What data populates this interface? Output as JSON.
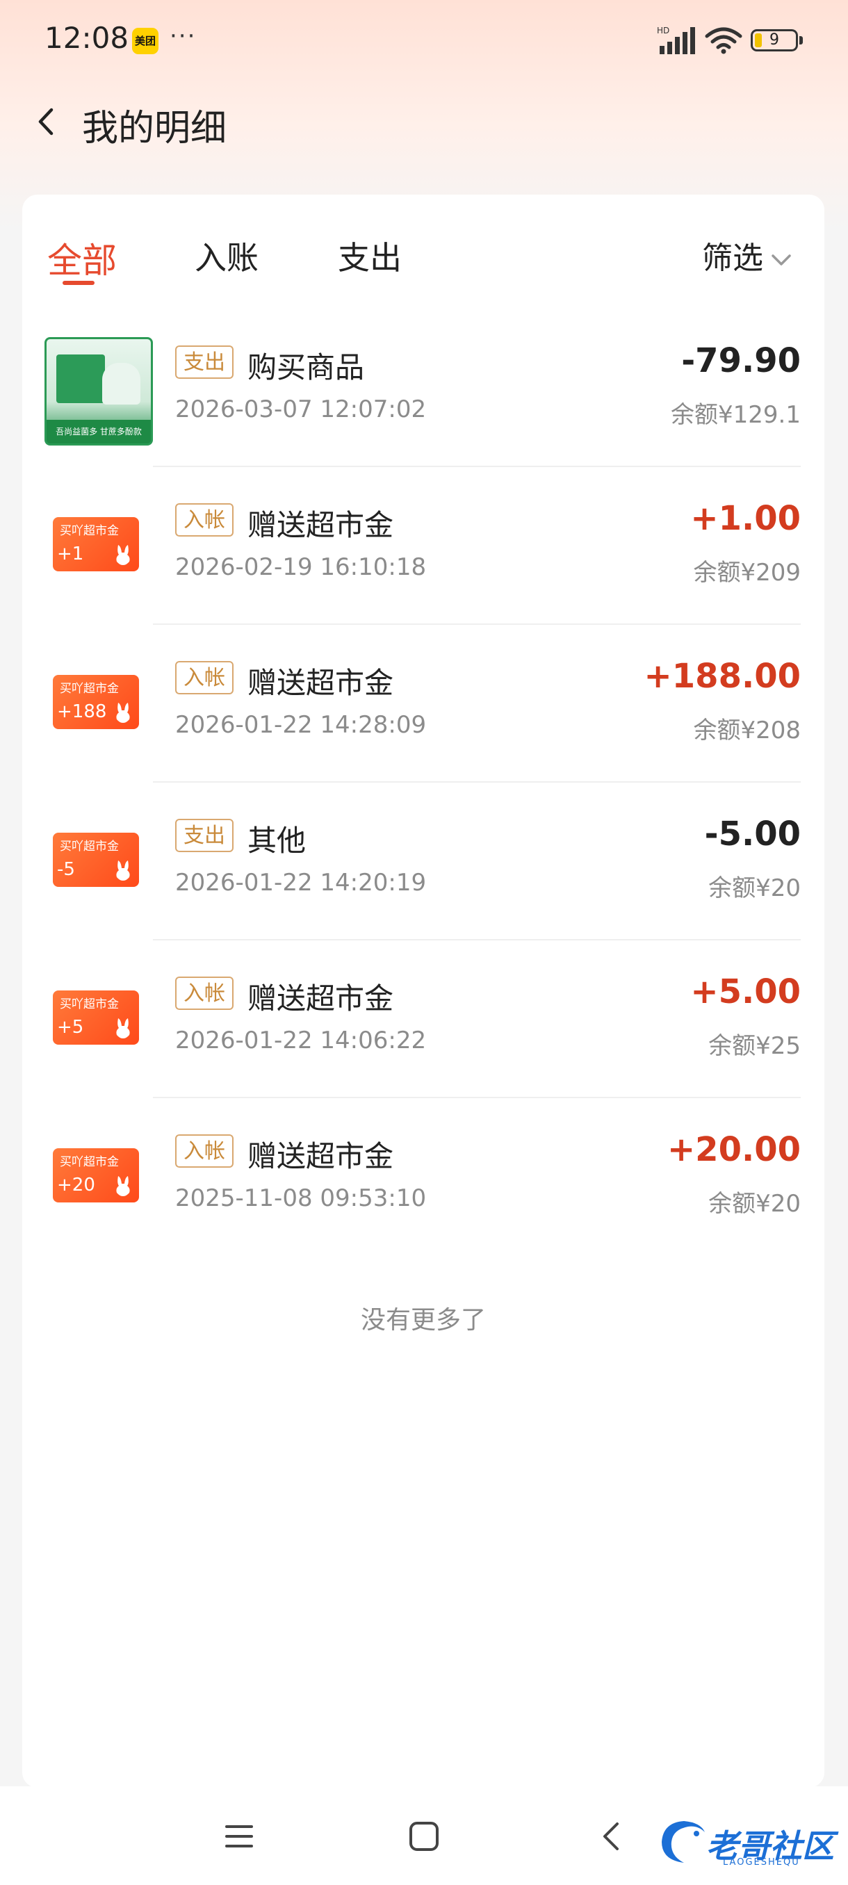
{
  "status_bar": {
    "time": "12:08",
    "app_badge": "美团",
    "more": "···",
    "network": "HD",
    "battery": "9"
  },
  "header": {
    "title": "我的明细"
  },
  "tabs": [
    {
      "label": "全部",
      "active": true
    },
    {
      "label": "入账",
      "active": false
    },
    {
      "label": "支出",
      "active": false
    }
  ],
  "filter": {
    "label": "筛选"
  },
  "records": [
    {
      "thumb": "product",
      "thumb_text": "吾尚益菌多 甘蔗多酚款",
      "tag": "支出",
      "name": "购买商品",
      "time": "2026-03-07 12:07:02",
      "amount": "-79.90",
      "balance": "余额¥129.1",
      "type": "out"
    },
    {
      "thumb": "coupon",
      "coupon_label": "买吖超市金",
      "coupon_value": "+1",
      "tag": "入帐",
      "name": "赠送超市金",
      "time": "2026-02-19 16:10:18",
      "amount": "+1.00",
      "balance": "余额¥209",
      "type": "in"
    },
    {
      "thumb": "coupon",
      "coupon_label": "买吖超市金",
      "coupon_value": "+188",
      "tag": "入帐",
      "name": "赠送超市金",
      "time": "2026-01-22 14:28:09",
      "amount": "+188.00",
      "balance": "余额¥208",
      "type": "in"
    },
    {
      "thumb": "coupon",
      "coupon_label": "买吖超市金",
      "coupon_value": "-5",
      "tag": "支出",
      "name": "其他",
      "time": "2026-01-22 14:20:19",
      "amount": "-5.00",
      "balance": "余额¥20",
      "type": "out"
    },
    {
      "thumb": "coupon",
      "coupon_label": "买吖超市金",
      "coupon_value": "+5",
      "tag": "入帐",
      "name": "赠送超市金",
      "time": "2026-01-22 14:06:22",
      "amount": "+5.00",
      "balance": "余额¥25",
      "type": "in"
    },
    {
      "thumb": "coupon",
      "coupon_label": "买吖超市金",
      "coupon_value": "+20",
      "tag": "入帐",
      "name": "赠送超市金",
      "time": "2025-11-08 09:53:10",
      "amount": "+20.00",
      "balance": "余额¥20",
      "type": "in"
    }
  ],
  "footer_text": "没有更多了",
  "watermark": {
    "text": "老哥社区",
    "sub": "LAOGESHEQU"
  },
  "colors": {
    "accent": "#e64a2e",
    "income": "#d33c1f",
    "tag_border": "#d9a870",
    "coupon": "#ff5a22"
  }
}
